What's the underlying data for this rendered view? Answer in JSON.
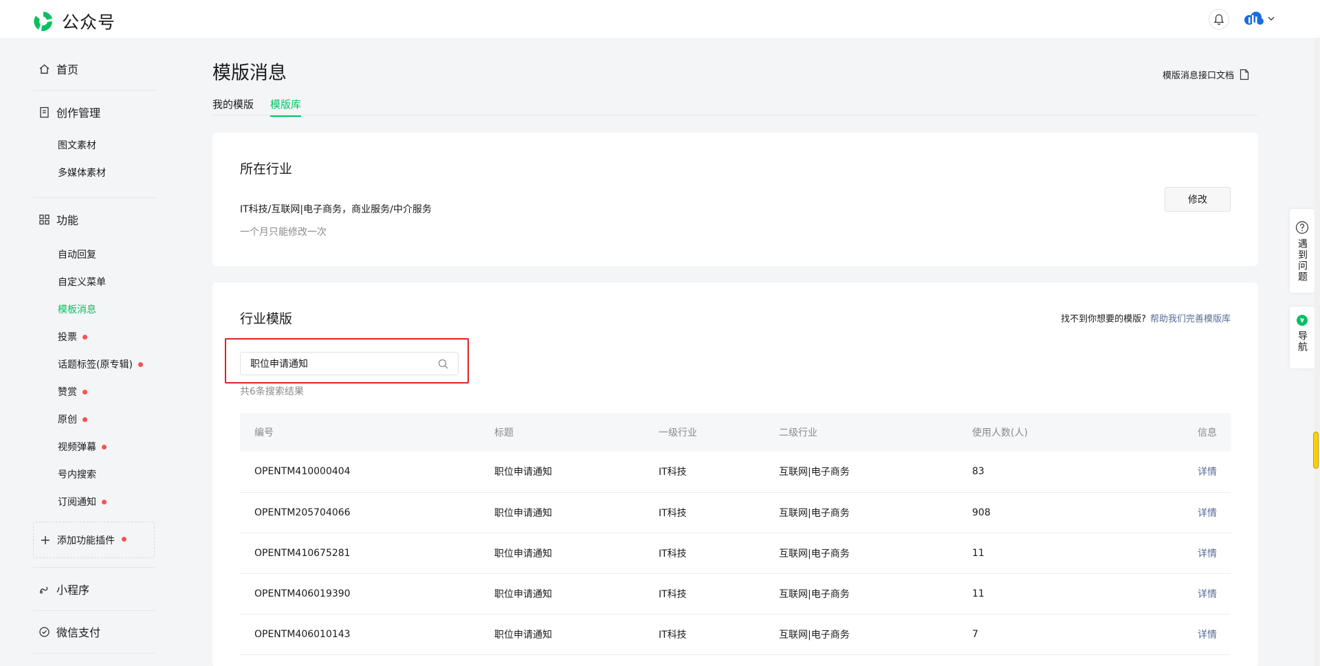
{
  "header": {
    "logo_text": "公众号",
    "brand_color": "#07c160"
  },
  "sidebar": {
    "home": "首页",
    "create": "创作管理",
    "create_items": [
      "图文素材",
      "多媒体素材"
    ],
    "features": "功能",
    "feature_items": [
      {
        "label": "自动回复",
        "dot": false,
        "active": false
      },
      {
        "label": "自定义菜单",
        "dot": false,
        "active": false
      },
      {
        "label": "模板消息",
        "dot": false,
        "active": true
      },
      {
        "label": "投票",
        "dot": true,
        "active": false
      },
      {
        "label": "话题标签(原专辑)",
        "dot": true,
        "active": false
      },
      {
        "label": "赞赏",
        "dot": true,
        "active": false
      },
      {
        "label": "原创",
        "dot": true,
        "active": false
      },
      {
        "label": "视频弹幕",
        "dot": true,
        "active": false
      },
      {
        "label": "号内搜索",
        "dot": false,
        "active": false
      },
      {
        "label": "订阅通知",
        "dot": true,
        "active": false
      }
    ],
    "add_plugin": "添加功能插件",
    "mini_program": "小程序",
    "wechat_pay": "微信支付"
  },
  "main": {
    "title": "模版消息",
    "doc_link": "模版消息接口文档",
    "tabs": [
      {
        "label": "我的模版",
        "active": false
      },
      {
        "label": "模版库",
        "active": true
      }
    ],
    "industry_card": {
      "heading": "所在行业",
      "industry": "IT科技/互联网|电子商务，商业服务/中介服务",
      "note": "一个月只能修改一次",
      "edit_button": "修改"
    },
    "template_card": {
      "heading": "行业模版",
      "help_text": "找不到你想要的模版?",
      "help_link": "帮助我们完善模版库",
      "search_value": "职位申请通知",
      "result_count": "共6条搜索结果",
      "columns": [
        "编号",
        "标题",
        "一级行业",
        "二级行业",
        "使用人数(人)",
        "信息"
      ],
      "rows": [
        [
          "OPENTM410000404",
          "职位申请通知",
          "IT科技",
          "互联网|电子商务",
          "83",
          "详情"
        ],
        [
          "OPENTM205704066",
          "职位申请通知",
          "IT科技",
          "互联网|电子商务",
          "908",
          "详情"
        ],
        [
          "OPENTM410675281",
          "职位申请通知",
          "IT科技",
          "互联网|电子商务",
          "11",
          "详情"
        ],
        [
          "OPENTM406019390",
          "职位申请通知",
          "IT科技",
          "互联网|电子商务",
          "11",
          "详情"
        ],
        [
          "OPENTM406010143",
          "职位申请通知",
          "IT科技",
          "互联网|电子商务",
          "7",
          "详情"
        ]
      ]
    }
  },
  "float_tools": {
    "help": "遇到问题",
    "guide": "导航"
  }
}
